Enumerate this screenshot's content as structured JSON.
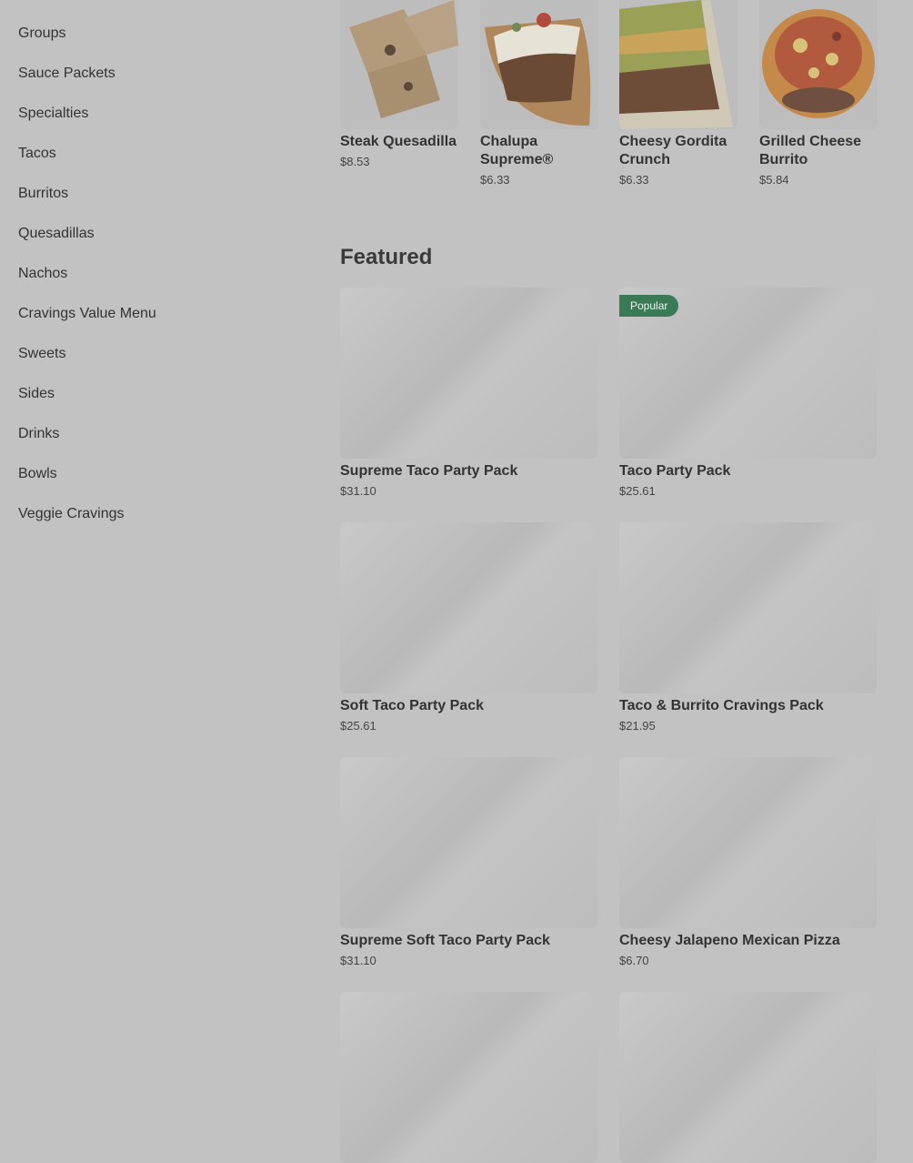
{
  "sidebar": {
    "items": [
      {
        "label": "Groups"
      },
      {
        "label": "Sauce Packets"
      },
      {
        "label": "Specialties"
      },
      {
        "label": "Tacos"
      },
      {
        "label": "Burritos"
      },
      {
        "label": "Quesadillas"
      },
      {
        "label": "Nachos"
      },
      {
        "label": "Cravings Value Menu"
      },
      {
        "label": "Sweets"
      },
      {
        "label": "Sides"
      },
      {
        "label": "Drinks"
      },
      {
        "label": "Bowls"
      },
      {
        "label": "Veggie Cravings"
      }
    ]
  },
  "top_items": [
    {
      "name": "Steak Quesadilla",
      "price": "$8.53",
      "image": "steak-quesadilla-image"
    },
    {
      "name": "Chalupa Supreme®",
      "price": "$6.33",
      "image": "chalupa-supreme-image"
    },
    {
      "name": "Cheesy Gordita Crunch",
      "price": "$6.33",
      "image": "cheesy-gordita-crunch-image"
    },
    {
      "name": "Grilled Cheese Burrito",
      "price": "$5.84",
      "image": "grilled-cheese-burrito-image"
    }
  ],
  "featured": {
    "title": "Featured",
    "badge": "Popular",
    "items": [
      {
        "name": "Supreme Taco Party Pack",
        "price": "$31.10"
      },
      {
        "name": "Taco Party Pack",
        "price": "$25.61"
      },
      {
        "name": "Soft Taco Party Pack",
        "price": "$25.61"
      },
      {
        "name": "Taco & Burrito Cravings Pack",
        "price": "$21.95"
      },
      {
        "name": "Supreme Soft Taco Party Pack",
        "price": "$31.10"
      },
      {
        "name": "Cheesy Jalapeno Mexican Pizza",
        "price": "$6.70"
      }
    ]
  },
  "colors": {
    "overlay": "#c2c2c2",
    "badge": "#3b7a57"
  }
}
